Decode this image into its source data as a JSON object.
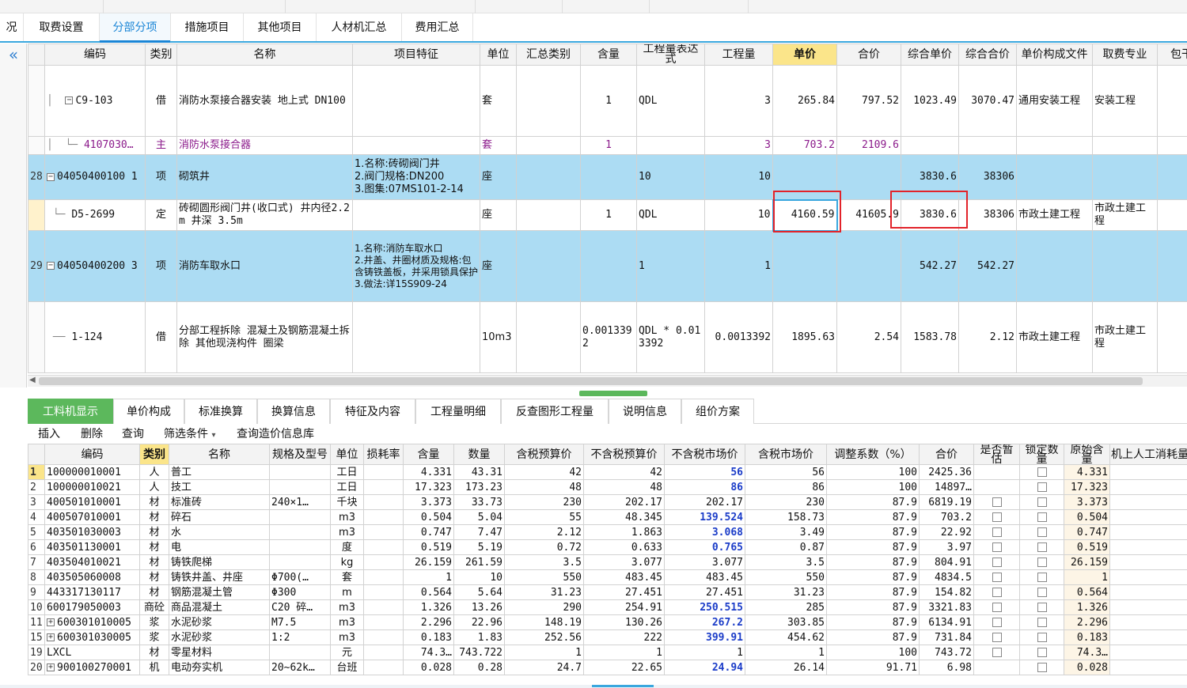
{
  "tabs": [
    {
      "label": "况"
    },
    {
      "label": "取费设置"
    },
    {
      "label": "分部分项",
      "active": true
    },
    {
      "label": "措施项目"
    },
    {
      "label": "其他项目"
    },
    {
      "label": "人材机汇总"
    },
    {
      "label": "费用汇总"
    }
  ],
  "upper": {
    "headers": [
      "编码",
      "类别",
      "名称",
      "项目特征",
      "单位",
      "汇总类别",
      "含量",
      "工程量表达式",
      "工程量",
      "单价",
      "合价",
      "综合单价",
      "综合合价",
      "单价构成文件",
      "取费专业",
      "包干"
    ],
    "rows": [
      {
        "kind": "normal",
        "rn": "",
        "code": "C9-103",
        "toggle": "−",
        "type": "借",
        "name": "消防水泵接合器安装 地上式 DN100",
        "feature": "",
        "unit": "套",
        "sumcat": "",
        "qty": "1",
        "expr": "QDL",
        "amount": "3",
        "price": "265.84",
        "total": "797.52",
        "cprice": "1023.49",
        "ctotal": "3070.47",
        "file": "通用安装工程",
        "spec": "安装工程"
      },
      {
        "kind": "main",
        "rn": "",
        "code": "4107030…",
        "toggle": "",
        "type": "主",
        "name": "消防水泵接合器",
        "feature": "",
        "unit": "套",
        "sumcat": "",
        "qty": "1",
        "expr": "",
        "amount": "3",
        "price": "703.2",
        "total": "2109.6",
        "cprice": "",
        "ctotal": "",
        "file": "",
        "spec": ""
      },
      {
        "kind": "item",
        "rn": "28",
        "code": "04050400100 1",
        "toggle": "−",
        "type": "项",
        "name": "砌筑井",
        "feature": "1.名称:砖砌阀门井\n2.阀门规格:DN200\n3.图集:07MS101-2-14",
        "unit": "座",
        "sumcat": "",
        "qty": "",
        "expr": "10",
        "amount": "10",
        "price": "",
        "total": "",
        "cprice": "3830.6",
        "ctotal": "38306",
        "file": "",
        "spec": ""
      },
      {
        "kind": "sel",
        "rn": "",
        "code": "D5-2699",
        "toggle": "",
        "type": "定",
        "name": "砖砌圆形阀门井(收口式) 井内径2.2m 井深 3.5m",
        "feature": "",
        "unit": "座",
        "sumcat": "",
        "qty": "1",
        "expr": "QDL",
        "amount": "10",
        "price": "4160.59",
        "total": "41605.9",
        "cprice": "3830.6",
        "ctotal": "38306",
        "file": "市政土建工程",
        "spec": "市政土建工程"
      },
      {
        "kind": "item",
        "rn": "29",
        "code": "04050400200 3",
        "toggle": "−",
        "type": "项",
        "name": "消防车取水口",
        "feature": "1.名称:消防车取水口\n2.井盖、井圈材质及规格:包含铸铁盖板，并采用锁具保护\n3.做法:详15S909-24",
        "unit": "座",
        "sumcat": "",
        "qty": "",
        "expr": "1",
        "amount": "1",
        "price": "",
        "total": "",
        "cprice": "542.27",
        "ctotal": "542.27",
        "file": "",
        "spec": ""
      },
      {
        "kind": "normal",
        "rn": "",
        "code": "1-124",
        "toggle": "",
        "type": "借",
        "name": "分部工程拆除 混凝土及钢筋混凝土拆除 其他现浇构件 圈梁",
        "feature": "",
        "unit": "10m3",
        "sumcat": "",
        "qty": "0.001339 2",
        "expr": "QDL * 0.013392",
        "amount": "0.0013392",
        "price": "1895.63",
        "total": "2.54",
        "cprice": "1583.78",
        "ctotal": "2.12",
        "file": "市政土建工程",
        "spec": "市政土建工程"
      }
    ]
  },
  "bottom_tabs": [
    {
      "label": "工料机显示",
      "active": true
    },
    {
      "label": "单价构成"
    },
    {
      "label": "标准换算"
    },
    {
      "label": "换算信息"
    },
    {
      "label": "特征及内容"
    },
    {
      "label": "工程量明细"
    },
    {
      "label": "反查图形工程量"
    },
    {
      "label": "说明信息"
    },
    {
      "label": "组价方案"
    }
  ],
  "toolbar": {
    "insert": "插入",
    "delete": "删除",
    "query": "查询",
    "filter": "筛选条件",
    "filter_arrow": "▾",
    "query_price": "查询造价信息库"
  },
  "lower": {
    "headers": [
      "编码",
      "类别",
      "名称",
      "规格及型号",
      "单位",
      "损耗率",
      "含量",
      "数量",
      "含税预算价",
      "不含税预算价",
      "不含税市场价",
      "含税市场价",
      "调整系数（%）",
      "合价",
      "是否暂估",
      "锁定数量",
      "原始含量",
      "机上人工消耗量"
    ],
    "rows": [
      {
        "rn": "1",
        "toggle": "",
        "code": "100000010001",
        "type": "人",
        "name": "普工",
        "spec": "",
        "unit": "工日",
        "loss": "",
        "qty": "4.331",
        "count": "43.31",
        "tpre": "42",
        "ntpre": "42",
        "ntmkt": "56",
        "blue": true,
        "tmkt": "56",
        "coef": "100",
        "total": "2425.36",
        "est": "",
        "lock": "cb",
        "orig": "4.331"
      },
      {
        "rn": "2",
        "toggle": "",
        "code": "100000010021",
        "type": "人",
        "name": "技工",
        "spec": "",
        "unit": "工日",
        "loss": "",
        "qty": "17.323",
        "count": "173.23",
        "tpre": "48",
        "ntpre": "48",
        "ntmkt": "86",
        "blue": true,
        "tmkt": "86",
        "coef": "100",
        "total": "14897…",
        "est": "",
        "lock": "cb",
        "orig": "17.323"
      },
      {
        "rn": "3",
        "toggle": "",
        "code": "400501010001",
        "type": "材",
        "name": "标准砖",
        "spec": "240×1…",
        "unit": "千块",
        "loss": "",
        "qty": "3.373",
        "count": "33.73",
        "tpre": "230",
        "ntpre": "202.17",
        "ntmkt": "202.17",
        "blue": false,
        "tmkt": "230",
        "coef": "87.9",
        "total": "6819.19",
        "est": "cb",
        "lock": "cb",
        "orig": "3.373"
      },
      {
        "rn": "4",
        "toggle": "",
        "code": "400507010001",
        "type": "材",
        "name": "碎石",
        "spec": "",
        "unit": "m3",
        "loss": "",
        "qty": "0.504",
        "count": "5.04",
        "tpre": "55",
        "ntpre": "48.345",
        "ntmkt": "139.524",
        "blue": true,
        "tmkt": "158.73",
        "coef": "87.9",
        "total": "703.2",
        "est": "cb",
        "lock": "cb",
        "orig": "0.504"
      },
      {
        "rn": "5",
        "toggle": "",
        "code": "403501030003",
        "type": "材",
        "name": "水",
        "spec": "",
        "unit": "m3",
        "loss": "",
        "qty": "0.747",
        "count": "7.47",
        "tpre": "2.12",
        "ntpre": "1.863",
        "ntmkt": "3.068",
        "blue": true,
        "tmkt": "3.49",
        "coef": "87.9",
        "total": "22.92",
        "est": "cb",
        "lock": "cb",
        "orig": "0.747"
      },
      {
        "rn": "6",
        "toggle": "",
        "code": "403501130001",
        "type": "材",
        "name": "电",
        "spec": "",
        "unit": "度",
        "loss": "",
        "qty": "0.519",
        "count": "5.19",
        "tpre": "0.72",
        "ntpre": "0.633",
        "ntmkt": "0.765",
        "blue": true,
        "tmkt": "0.87",
        "coef": "87.9",
        "total": "3.97",
        "est": "cb",
        "lock": "cb",
        "orig": "0.519"
      },
      {
        "rn": "7",
        "toggle": "",
        "code": "403504010021",
        "type": "材",
        "name": "铸铁爬梯",
        "spec": "",
        "unit": "kg",
        "loss": "",
        "qty": "26.159",
        "count": "261.59",
        "tpre": "3.5",
        "ntpre": "3.077",
        "ntmkt": "3.077",
        "blue": false,
        "tmkt": "3.5",
        "coef": "87.9",
        "total": "804.91",
        "est": "cb",
        "lock": "cb",
        "orig": "26.159"
      },
      {
        "rn": "8",
        "toggle": "",
        "code": "403505060008",
        "type": "材",
        "name": "铸铁井盖、井座",
        "spec": "Φ700(…",
        "unit": "套",
        "loss": "",
        "qty": "1",
        "count": "10",
        "tpre": "550",
        "ntpre": "483.45",
        "ntmkt": "483.45",
        "blue": false,
        "tmkt": "550",
        "coef": "87.9",
        "total": "4834.5",
        "est": "cb",
        "lock": "cb",
        "orig": "1"
      },
      {
        "rn": "9",
        "toggle": "",
        "code": "443317130117",
        "type": "材",
        "name": "钢筋混凝土管",
        "spec": "Φ300",
        "unit": "m",
        "loss": "",
        "qty": "0.564",
        "count": "5.64",
        "tpre": "31.23",
        "ntpre": "27.451",
        "ntmkt": "27.451",
        "blue": false,
        "tmkt": "31.23",
        "coef": "87.9",
        "total": "154.82",
        "est": "cb",
        "lock": "cb",
        "orig": "0.564"
      },
      {
        "rn": "10",
        "toggle": "",
        "code": "600179050003",
        "type": "商砼",
        "name": "商品混凝土",
        "spec": "C20 碎…",
        "unit": "m3",
        "loss": "",
        "qty": "1.326",
        "count": "13.26",
        "tpre": "290",
        "ntpre": "254.91",
        "ntmkt": "250.515",
        "blue": true,
        "tmkt": "285",
        "coef": "87.9",
        "total": "3321.83",
        "est": "cb",
        "lock": "cb",
        "orig": "1.326"
      },
      {
        "rn": "11",
        "toggle": "+",
        "code": "600301010005",
        "type": "浆",
        "name": "水泥砂浆",
        "spec": "M7.5",
        "unit": "m3",
        "loss": "",
        "qty": "2.296",
        "count": "22.96",
        "tpre": "148.19",
        "ntpre": "130.26",
        "ntmkt": "267.2",
        "blue": true,
        "tmkt": "303.85",
        "coef": "87.9",
        "total": "6134.91",
        "est": "cb",
        "lock": "cb",
        "orig": "2.296"
      },
      {
        "rn": "15",
        "toggle": "+",
        "code": "600301030005",
        "type": "浆",
        "name": "水泥砂浆",
        "spec": "1:2",
        "unit": "m3",
        "loss": "",
        "qty": "0.183",
        "count": "1.83",
        "tpre": "252.56",
        "ntpre": "222",
        "ntmkt": "399.91",
        "blue": true,
        "tmkt": "454.62",
        "coef": "87.9",
        "total": "731.84",
        "est": "cb",
        "lock": "cb",
        "orig": "0.183"
      },
      {
        "rn": "19",
        "toggle": "",
        "code": "LXCL",
        "type": "材",
        "name": "零星材料",
        "spec": "",
        "unit": "元",
        "loss": "",
        "qty": "74.3…",
        "count": "743.722",
        "tpre": "1",
        "ntpre": "1",
        "ntmkt": "1",
        "blue": false,
        "tmkt": "1",
        "coef": "100",
        "total": "743.72",
        "est": "cb",
        "lock": "cb",
        "orig": "74.3…"
      },
      {
        "rn": "20",
        "toggle": "+",
        "code": "900100270001",
        "type": "机",
        "name": "电动夯实机",
        "spec": "20~62k…",
        "unit": "台班",
        "loss": "",
        "qty": "0.028",
        "count": "0.28",
        "tpre": "24.7",
        "ntpre": "22.65",
        "ntmkt": "24.94",
        "blue": true,
        "tmkt": "26.14",
        "coef": "91.71",
        "total": "6.98",
        "est": "",
        "lock": "cb",
        "orig": "0.028"
      }
    ]
  },
  "colors": {
    "tab_accent": "#1a85d6",
    "item_row": "#acdcf3",
    "main_material": "#8b1a8b",
    "highlight_header": "#fbe58a",
    "active_bottom_tab": "#5cb85c",
    "market_price": "#1b3cc8",
    "annotation": "#e2232a"
  }
}
